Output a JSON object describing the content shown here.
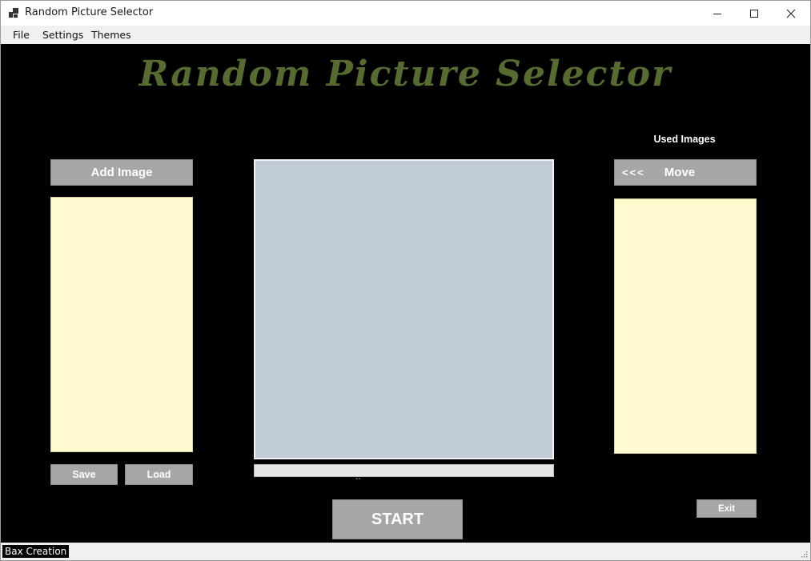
{
  "window": {
    "title": "Random Picture Selector",
    "icons": {
      "app": "app-icon",
      "minimize": "minimize-icon",
      "maximize": "maximize-icon",
      "close": "close-icon"
    }
  },
  "menu": [
    "File",
    "Settings",
    "Themes"
  ],
  "main": {
    "heading": "Random Picture Selector",
    "heading_color": "#556b2f",
    "add_image_label": "Add Image",
    "save_label": "Save",
    "load_label": "Load",
    "used_images_label": "Used Images",
    "move_arrows": "<<<",
    "move_label": "Move",
    "progress_caption": "``",
    "start_label": "START",
    "exit_label": "Exit"
  },
  "colors": {
    "background": "#000000",
    "button": "#a6a6a6",
    "listbox": "#fffacd",
    "picture": "#bfcbd7"
  },
  "status": {
    "text": "Bax Creation"
  }
}
